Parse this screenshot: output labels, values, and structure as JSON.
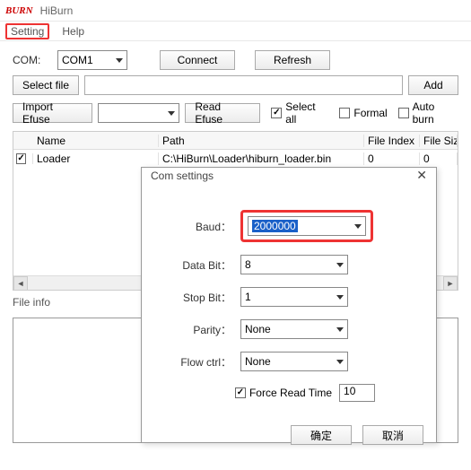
{
  "app": {
    "logo": "BURN",
    "title": "HiBurn"
  },
  "menu": {
    "setting": "Setting",
    "help": "Help"
  },
  "main": {
    "com_label": "COM:",
    "com_value": "COM1",
    "connect": "Connect",
    "refresh": "Refresh",
    "select_file": "Select file",
    "add": "Add",
    "import_efuse": "Import Efuse",
    "read_efuse": "Read Efuse",
    "select_all": "Select all",
    "formal": "Formal",
    "auto_burn": "Auto burn"
  },
  "table": {
    "headers": {
      "name": "Name",
      "path": "Path",
      "file_index": "File Index",
      "file_size": "File Siz"
    },
    "rows": [
      {
        "checked": true,
        "name": "Loader",
        "path": "C:\\HiBurn\\Loader\\hiburn_loader.bin",
        "file_index": "0",
        "file_size": "0"
      }
    ]
  },
  "fileinfo_label": "File info",
  "dialog": {
    "title": "Com settings",
    "baud_label": "Baud：",
    "baud_value": "2000000",
    "databit_label": "Data Bit：",
    "databit_value": "8",
    "stopbit_label": "Stop Bit：",
    "stopbit_value": "1",
    "parity_label": "Parity：",
    "parity_value": "None",
    "flow_label": "Flow ctrl：",
    "flow_value": "None",
    "force_read_time": "Force Read Time",
    "force_read_time_value": "10",
    "ok": "确定",
    "cancel": "取消"
  }
}
